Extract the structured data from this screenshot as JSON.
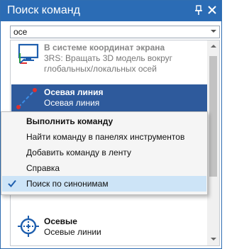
{
  "panel": {
    "title": "Поиск команд",
    "pin_icon": "pin-icon",
    "close_icon": "close-icon",
    "accent": "#2b6cb5"
  },
  "search": {
    "value": "осе",
    "placeholder": ""
  },
  "results": [
    {
      "title": "В системе координат экрана",
      "desc": "3RS: Вращать 3D модель вокруг глобальных/локальных осей",
      "icon": "screen-coordinate-system-icon",
      "state": "disabled"
    },
    {
      "title": "Осевая линия",
      "desc": "Осевая линия",
      "icon": "axis-line-icon",
      "state": "selected"
    },
    {
      "title": "Осевые",
      "desc": "Осевые линии",
      "icon": "center-marks-icon",
      "state": "normal"
    }
  ],
  "context_menu": {
    "items": [
      {
        "label": "Выполнить команду",
        "default": true
      },
      {
        "label": "Найти команду в панелях инструментов"
      },
      {
        "label": "Добавить команду в ленту"
      },
      {
        "label": "Справка"
      },
      {
        "label": "Поиск по синонимам",
        "checked": true
      }
    ],
    "highlight": "#cde4f7"
  },
  "colors": {
    "selected_row": "#2e5a9c",
    "icon_red": "#e0302f",
    "icon_blue": "#1f5fae"
  }
}
